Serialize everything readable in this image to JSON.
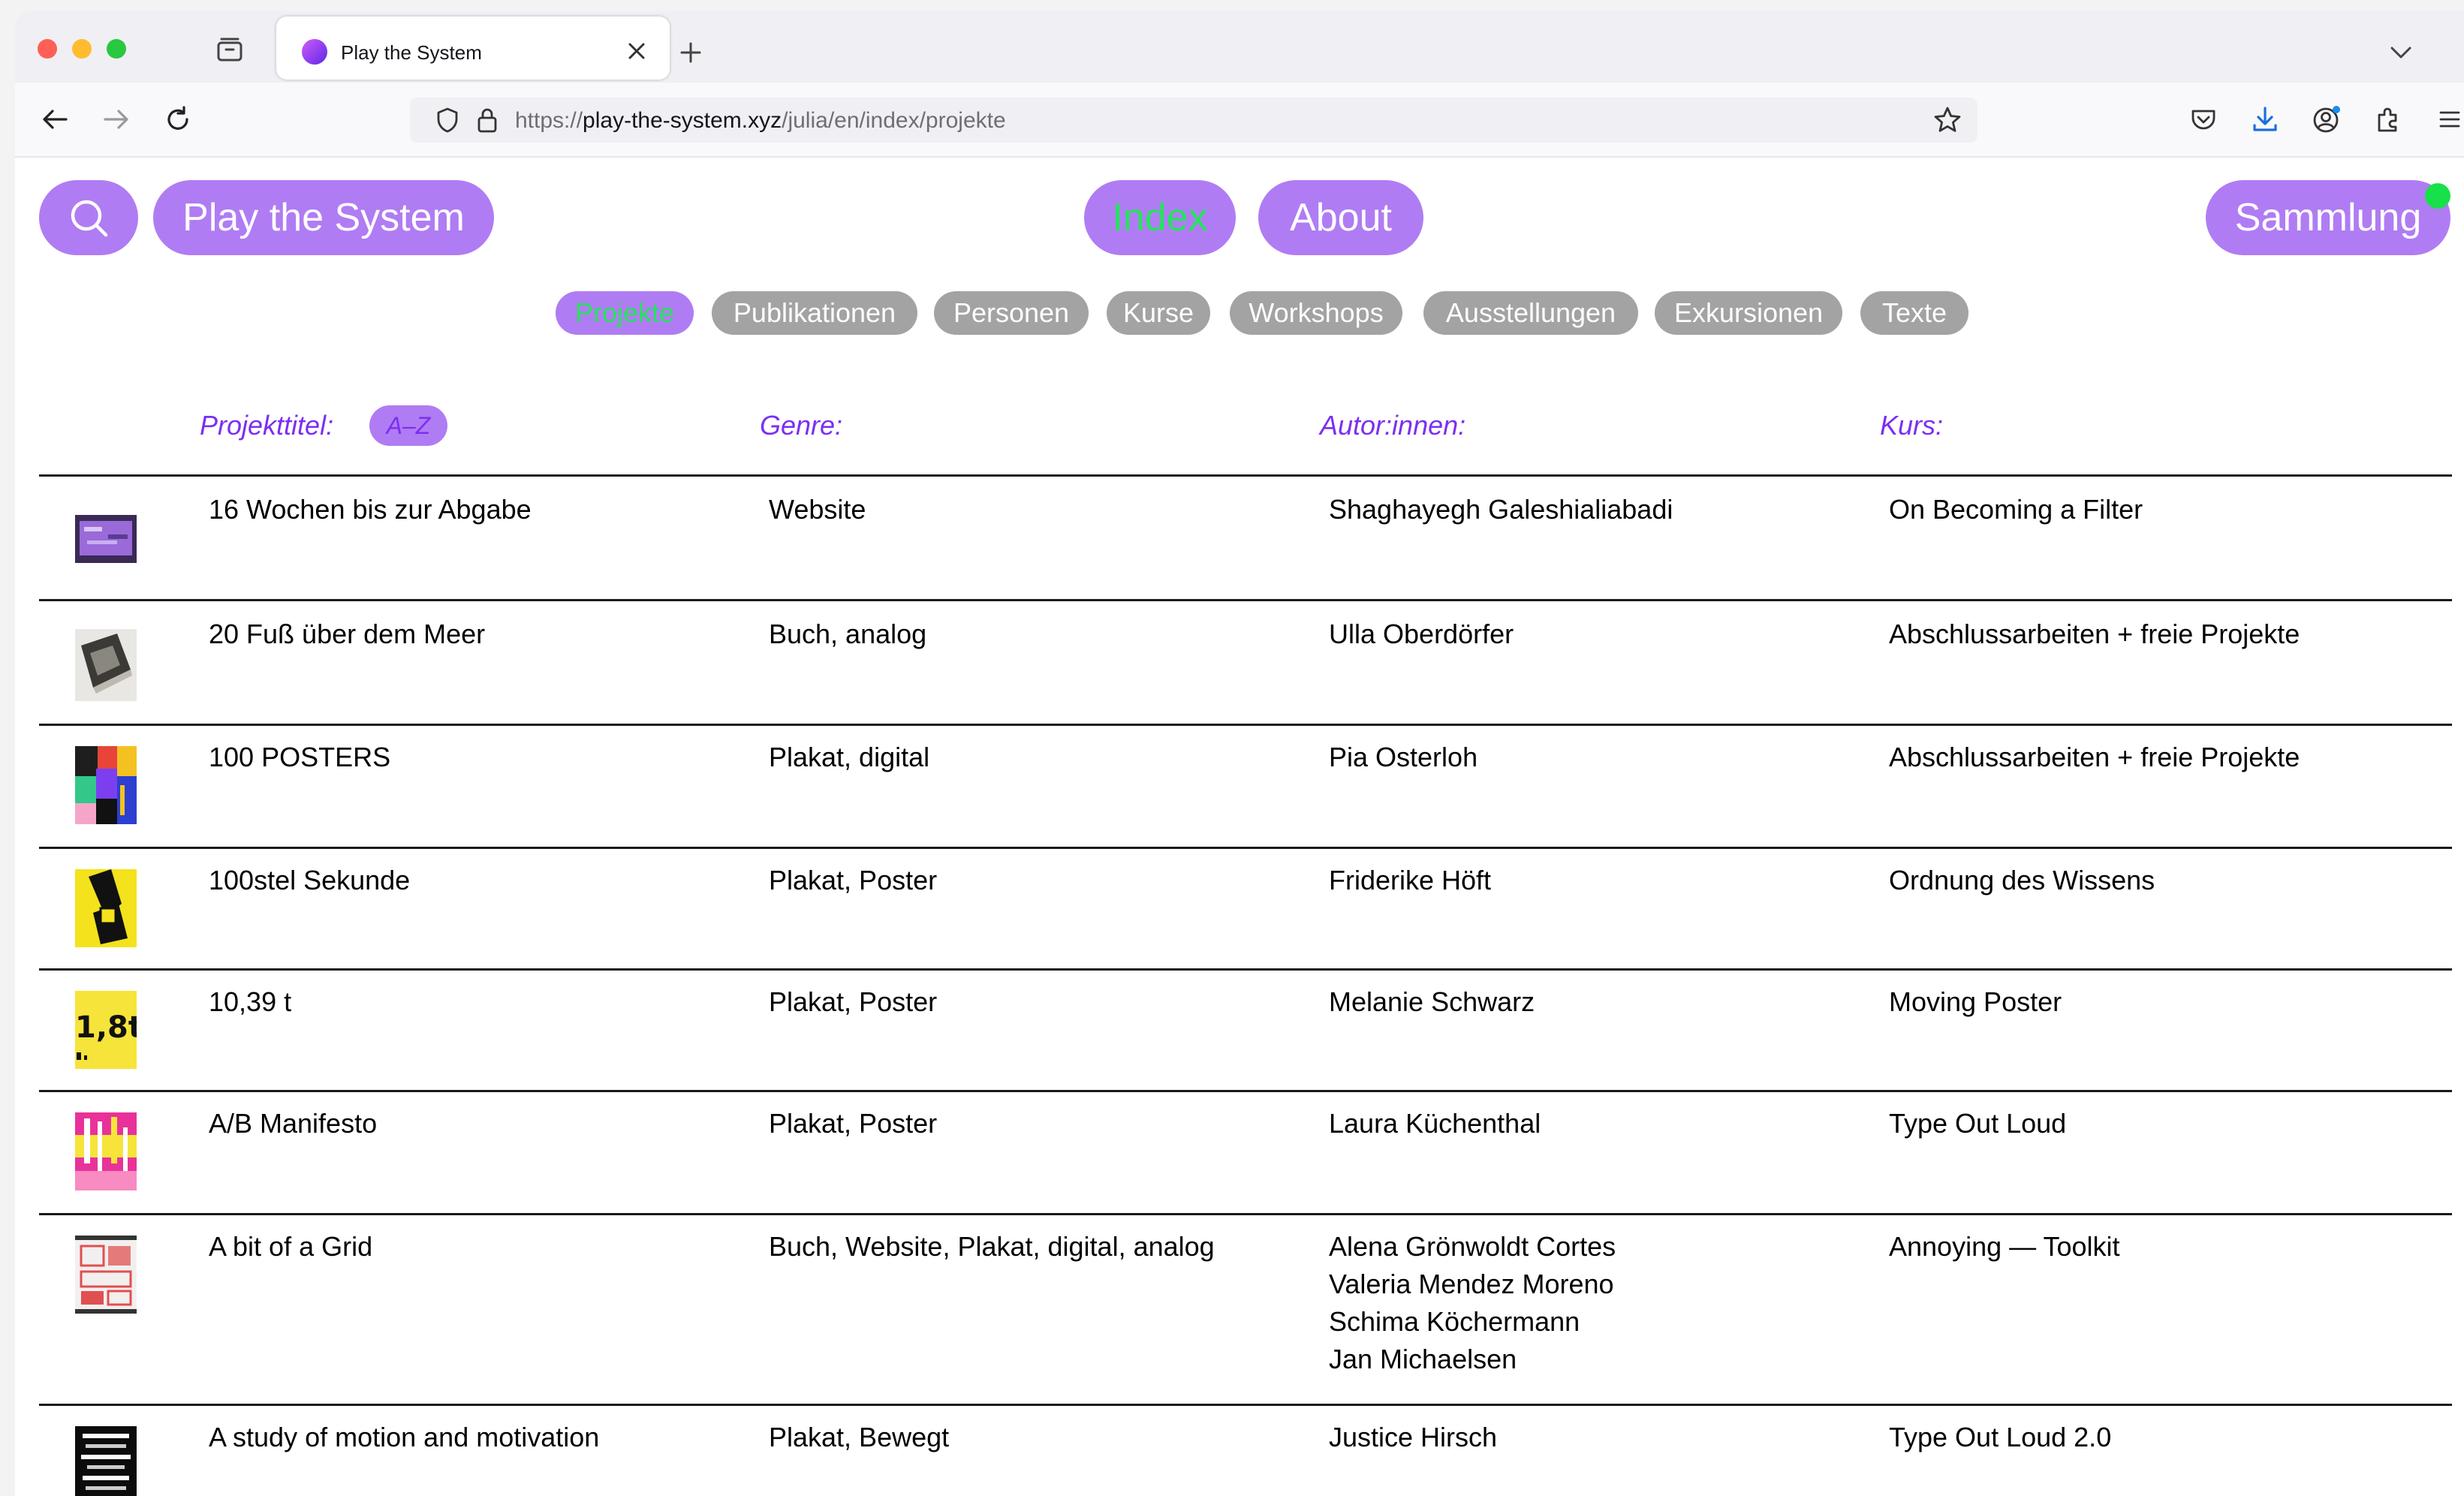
{
  "browser": {
    "tab_title": "Play the System",
    "url_prefix": "https://",
    "url_domain": "play-the-system.xyz",
    "url_path": "/julia/en/index/projekte"
  },
  "header": {
    "site_title": "Play the System",
    "nav": {
      "index": "Index",
      "about": "About",
      "sammlung": "Sammlung"
    },
    "notification_color": "#18e04a"
  },
  "categories": [
    {
      "label": "Projekte",
      "active": true
    },
    {
      "label": "Publikationen",
      "active": false
    },
    {
      "label": "Personen",
      "active": false
    },
    {
      "label": "Kurse",
      "active": false
    },
    {
      "label": "Workshops",
      "active": false
    },
    {
      "label": "Ausstellungen",
      "active": false
    },
    {
      "label": "Exkursionen",
      "active": false
    },
    {
      "label": "Texte",
      "active": false
    }
  ],
  "table": {
    "headers": {
      "title": "Projekttitel:",
      "sort": "A–Z",
      "genre": "Genre:",
      "authors": "Autor:innen:",
      "course": "Kurs:"
    },
    "rows": [
      {
        "title": "16 Wochen bis zur Abgabe",
        "genre": "Website",
        "authors": [
          "Shaghayegh Galeshialiabadi"
        ],
        "course": "On Becoming a Filter",
        "thumb": "purple-screen"
      },
      {
        "title": "20 Fuß über dem Meer",
        "genre": "Buch, analog",
        "authors": [
          "Ulla Oberdörfer"
        ],
        "course": "Abschlussarbeiten + freie Projekte",
        "thumb": "book-photo"
      },
      {
        "title": "100 POSTERS",
        "genre": "Plakat, digital",
        "authors": [
          "Pia Osterloh"
        ],
        "course": "Abschlussarbeiten + freie Projekte",
        "thumb": "poster-collage"
      },
      {
        "title": "100stel Sekunde",
        "genre": "Plakat, Poster",
        "authors": [
          "Friderike Höft"
        ],
        "course": "Ordnung des Wissens",
        "thumb": "yellow-poster"
      },
      {
        "title": "10,39 t",
        "genre": "Plakat, Poster",
        "authors": [
          "Melanie Schwarz"
        ],
        "course": "Moving Poster",
        "thumb": "yellow-type",
        "thumb_text": "1,8t"
      },
      {
        "title": "A/B Manifesto",
        "genre": "Plakat, Poster",
        "authors": [
          "Laura Küchenthal"
        ],
        "course": "Type Out Loud",
        "thumb": "pink-type"
      },
      {
        "title": "A bit of a Grid",
        "genre": "Buch, Website, Plakat, digital, analog",
        "authors": [
          "Alena Grönwoldt Cortes",
          "Valeria Mendez Moreno",
          "Schima Köchermann",
          "Jan Michaelsen"
        ],
        "course": "Annoying — Toolkit",
        "thumb": "red-grid"
      },
      {
        "title": "A study of motion and motivation",
        "genre": "Plakat, Bewegt",
        "authors": [
          "Justice Hirsch"
        ],
        "course": "Type Out Loud 2.0",
        "thumb": "black-type"
      }
    ]
  }
}
